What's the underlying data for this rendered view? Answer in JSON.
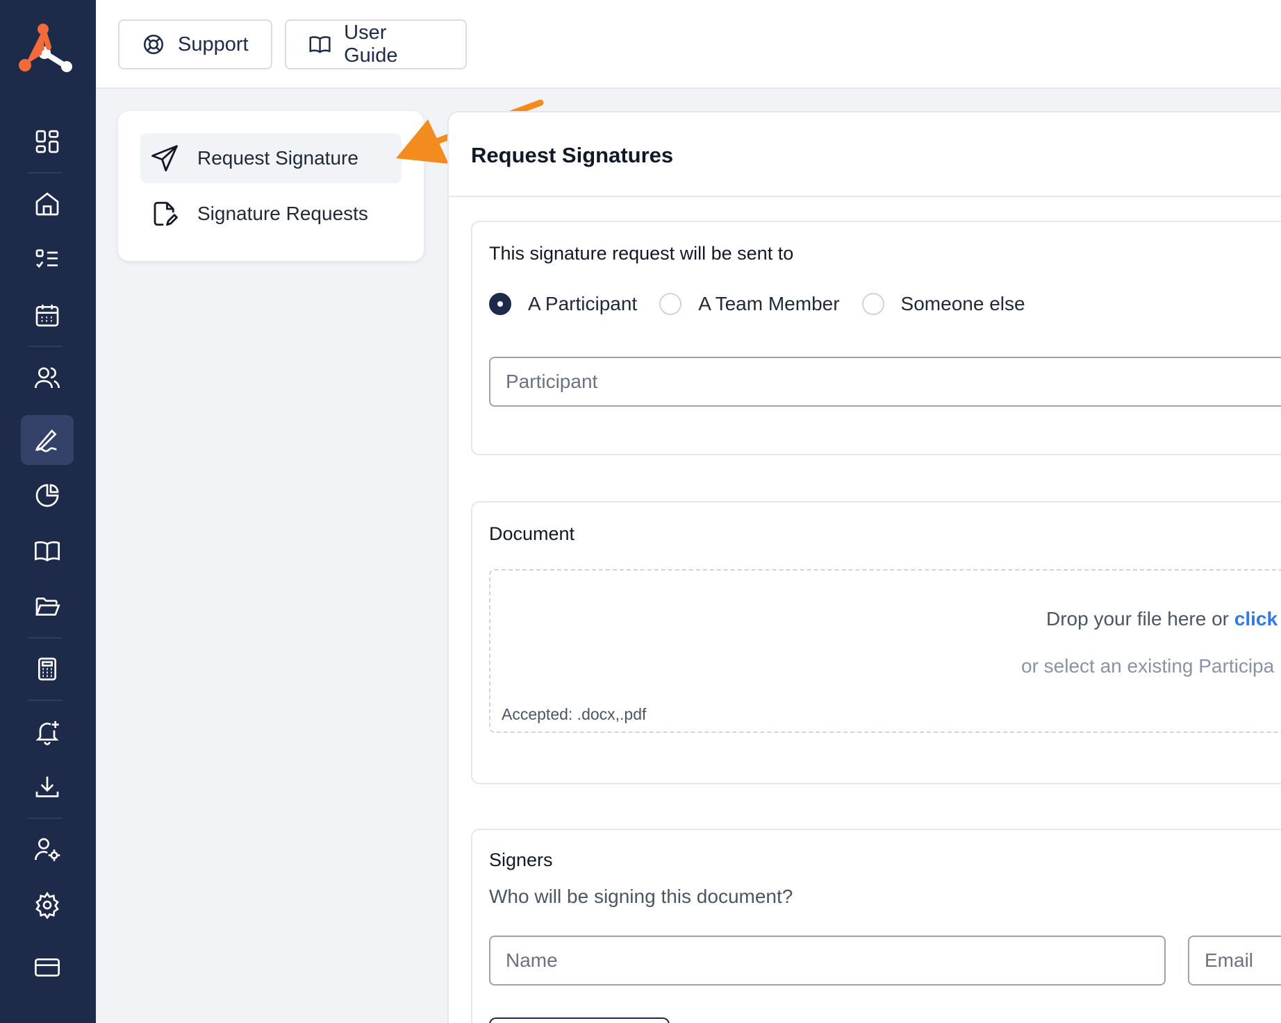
{
  "topbar": {
    "support_label": "Support",
    "guide_label": "User Guide"
  },
  "subnav": {
    "items": [
      {
        "label": "Request Signature",
        "icon": "send-icon",
        "active": true
      },
      {
        "label": "Signature Requests",
        "icon": "document-edit-icon",
        "active": false
      }
    ]
  },
  "sidebar": {
    "icons": [
      "dashboard-icon",
      "home-icon",
      "checklist-icon",
      "calendar-icon",
      "users-icon",
      "signature-icon",
      "pie-chart-icon",
      "book-icon",
      "folder-open-icon",
      "calculator-icon",
      "bell-plus-icon",
      "download-icon",
      "user-settings-icon",
      "gear-icon",
      "credit-card-icon"
    ],
    "active": "signature-icon"
  },
  "main": {
    "title": "Request Signatures",
    "recipient": {
      "title": "This signature request will be sent to",
      "options": [
        "A Participant",
        "A Team Member",
        "Someone else"
      ],
      "selected": "A Participant",
      "participant_placeholder": "Participant"
    },
    "document": {
      "title": "Document",
      "drop_text": "Drop your file here or ",
      "drop_link": "click",
      "select_text": "or select an existing Participa",
      "accepted": "Accepted: .docx,.pdf"
    },
    "signers": {
      "title": "Signers",
      "subtitle": "Who will be signing this document?",
      "name_placeholder": "Name",
      "email_placeholder": "Email"
    }
  },
  "colors": {
    "sidebar_bg": "#1e2a4a",
    "accent_orange": "#f28c1e",
    "link_blue": "#2f7ae5"
  }
}
